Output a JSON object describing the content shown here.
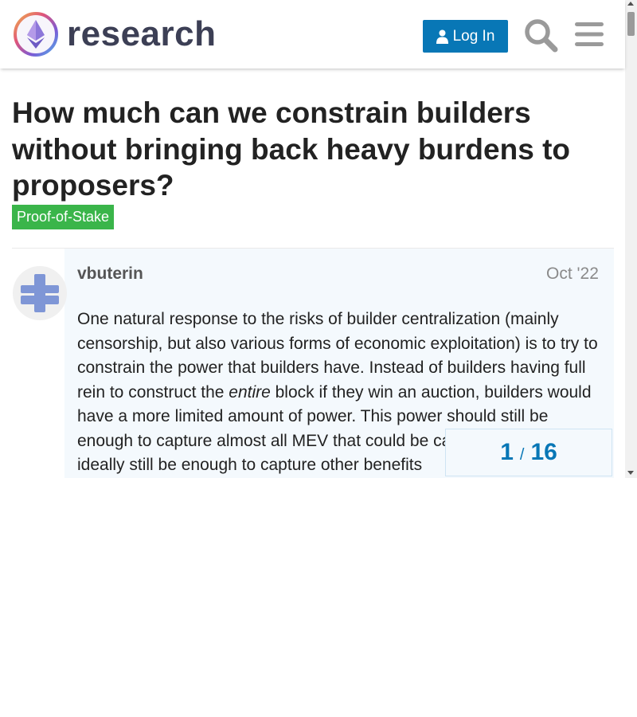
{
  "header": {
    "site_name": "research",
    "login_label": "Log In",
    "icons": [
      "ethereum-logo",
      "user-icon",
      "search-icon",
      "hamburger-menu-icon"
    ]
  },
  "topic": {
    "title": "How much can we constrain builders without bringing back heavy burdens to proposers?",
    "category": "Proof-of-Stake",
    "category_color": "#3ab54a"
  },
  "post": {
    "author": "vbuterin",
    "date": "Oct '22",
    "text_before_em": "One natural response to the risks of builder centralization (mainly censorship, but also various forms of economic exploitation) is to try to constrain the power that builders have. Instead of builders having full rein to construct the ",
    "text_em": "entire",
    "text_after_em": " block if they win an auction, builders would have a more limited amount of power. This power should still be enough to capture almost all MEV that could be captured, and should ideally still be enough to capture other benefits"
  },
  "progress": {
    "current": "1",
    "separator": "/",
    "total": "16"
  },
  "colors": {
    "accent": "#0877b6",
    "post_background": "#f4f9fd",
    "logo_text": "#3c3f55"
  }
}
